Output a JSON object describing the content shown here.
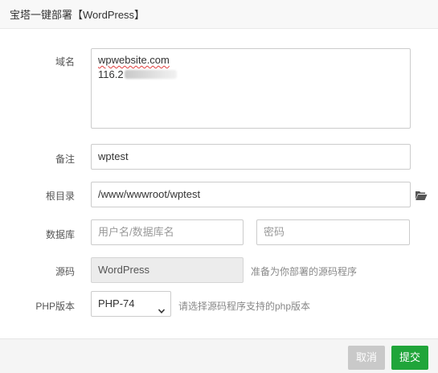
{
  "dialog": {
    "title": "宝塔一键部署【WordPress】"
  },
  "form": {
    "domain": {
      "label": "域名",
      "line1": "wpwebsite.com",
      "line2": "116.2"
    },
    "remark": {
      "label": "备注",
      "value": "wptest"
    },
    "root_dir": {
      "label": "根目录",
      "value": "/www/wwwroot/wptest",
      "icon": "folder-open-icon"
    },
    "database": {
      "label": "数据库",
      "user_placeholder": "用户名/数据库名",
      "password_placeholder": "密码"
    },
    "source": {
      "label": "源码",
      "value": "WordPress",
      "hint": "准备为你部署的源码程序"
    },
    "php_version": {
      "label": "PHP版本",
      "selected": "PHP-74",
      "hint": "请选择源码程序支持的php版本"
    }
  },
  "footer": {
    "cancel_label": "取消",
    "submit_label": "提交"
  },
  "colors": {
    "primary": "#20a53a",
    "cancel": "#c9c9c9",
    "folder": "#555555"
  }
}
